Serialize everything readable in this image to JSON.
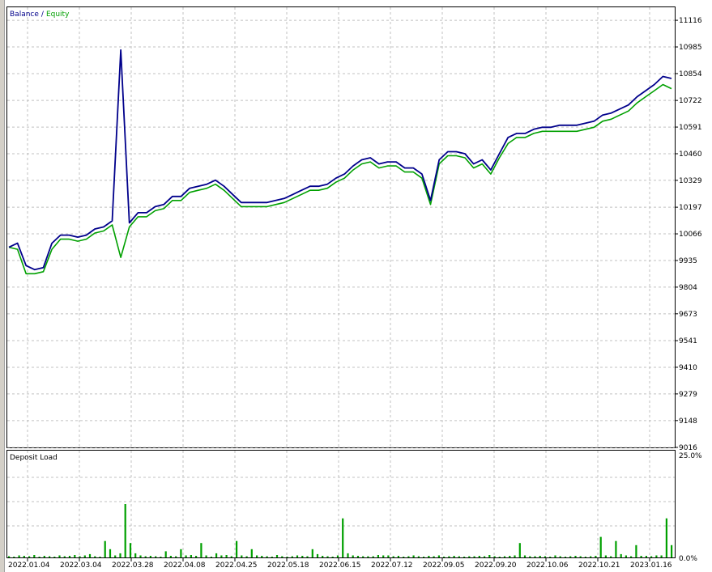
{
  "chart_data": [
    {
      "type": "line",
      "legend": {
        "balance_label": "Balance",
        "separator": "/",
        "equity_label": "Equity",
        "placement": "top-left"
      },
      "y_ticks": [
        9016,
        9148,
        9279,
        9410,
        9541,
        9673,
        9804,
        9935,
        10066,
        10197,
        10329,
        10460,
        10591,
        10722,
        10854,
        10985,
        11116
      ],
      "ylim": [
        9016,
        11180
      ],
      "x_tick_labels": [
        "2022.01.04",
        "2022.03.04",
        "2022.03.28",
        "2022.04.08",
        "2022.04.25",
        "2022.05.18",
        "2022.06.15",
        "2022.07.12",
        "2022.09.05",
        "2022.09.20",
        "2022.10.06",
        "2022.10.21",
        "2023.01.16"
      ],
      "grid": true,
      "colors": {
        "balance": "#00008b",
        "equity": "#00a000",
        "grid": "#c0c0c0"
      },
      "series": [
        {
          "name": "Balance",
          "values": [
            10000,
            10020,
            9910,
            9890,
            9900,
            10020,
            10060,
            10060,
            10050,
            10060,
            10090,
            10100,
            10130,
            10970,
            10120,
            10170,
            10170,
            10200,
            10210,
            10250,
            10250,
            10290,
            10300,
            10310,
            10330,
            10300,
            10260,
            10220,
            10220,
            10220,
            10220,
            10230,
            10240,
            10260,
            10280,
            10300,
            10300,
            10310,
            10340,
            10360,
            10400,
            10430,
            10440,
            10410,
            10420,
            10420,
            10390,
            10390,
            10360,
            10230,
            10430,
            10470,
            10470,
            10460,
            10410,
            10430,
            10380,
            10460,
            10540,
            10560,
            10560,
            10580,
            10590,
            10590,
            10600,
            10600,
            10600,
            10610,
            10620,
            10650,
            10660,
            10680,
            10700,
            10740,
            10770,
            10800,
            10840,
            10830
          ]
        },
        {
          "name": "Equity",
          "values": [
            10000,
            9990,
            9870,
            9870,
            9880,
            9990,
            10040,
            10040,
            10030,
            10040,
            10070,
            10080,
            10110,
            9950,
            10100,
            10150,
            10150,
            10180,
            10190,
            10230,
            10230,
            10270,
            10280,
            10290,
            10310,
            10280,
            10240,
            10200,
            10200,
            10200,
            10200,
            10210,
            10220,
            10240,
            10260,
            10280,
            10280,
            10290,
            10320,
            10340,
            10380,
            10410,
            10420,
            10390,
            10400,
            10400,
            10370,
            10370,
            10340,
            10210,
            10410,
            10450,
            10450,
            10440,
            10390,
            10410,
            10360,
            10440,
            10510,
            10540,
            10540,
            10560,
            10570,
            10570,
            10570,
            10570,
            10570,
            10580,
            10590,
            10620,
            10630,
            10650,
            10670,
            10710,
            10740,
            10770,
            10800,
            10780
          ]
        }
      ]
    },
    {
      "type": "bar",
      "title": "Deposit Load",
      "y_tick_labels": [
        "25.0%",
        "0.0%"
      ],
      "ylim": [
        0,
        25
      ],
      "color": "#00a000",
      "values": [
        0.3,
        0.2,
        0.5,
        0.4,
        0.3,
        0.6,
        0.2,
        0.4,
        0.3,
        0.2,
        0.5,
        0.3,
        0.4,
        0.6,
        0.3,
        0.5,
        0.8,
        0.3,
        0.2,
        4.0,
        2.0,
        0.5,
        1.0,
        13.0,
        3.5,
        1.0,
        0.5,
        0.3,
        0.4,
        0.3,
        0.2,
        1.5,
        0.4,
        0.3,
        2.0,
        0.5,
        0.6,
        0.4,
        3.5,
        0.5,
        0.2,
        1.0,
        0.5,
        0.6,
        0.3,
        4.0,
        0.5,
        0.3,
        2.0,
        0.5,
        0.4,
        0.3,
        0.2,
        0.6,
        0.3,
        0.2,
        0.3,
        0.5,
        0.4,
        0.3,
        2.0,
        0.8,
        0.4,
        0.3,
        0.2,
        0.5,
        9.5,
        1.0,
        0.5,
        0.4,
        0.3,
        0.3,
        0.3,
        0.6,
        0.5,
        0.5,
        0.3,
        0.4,
        0.2,
        0.3,
        0.5,
        0.3,
        0.2,
        0.4,
        0.3,
        0.5,
        0.2,
        0.3,
        0.4,
        0.3,
        0.2,
        0.3,
        0.3,
        0.4,
        0.3,
        0.6,
        0.3,
        0.2,
        0.3,
        0.4,
        0.5,
        3.5,
        0.5,
        0.3,
        0.3,
        0.4,
        0.3,
        0.2,
        0.5,
        0.3,
        0.2,
        0.3,
        0.4,
        0.3,
        0.2,
        0.3,
        0.4,
        5.0,
        0.5,
        0.3,
        4.0,
        0.8,
        0.5,
        0.3,
        3.0,
        0.4,
        0.4,
        0.3,
        0.5,
        0.5,
        9.5,
        3.0
      ]
    }
  ]
}
